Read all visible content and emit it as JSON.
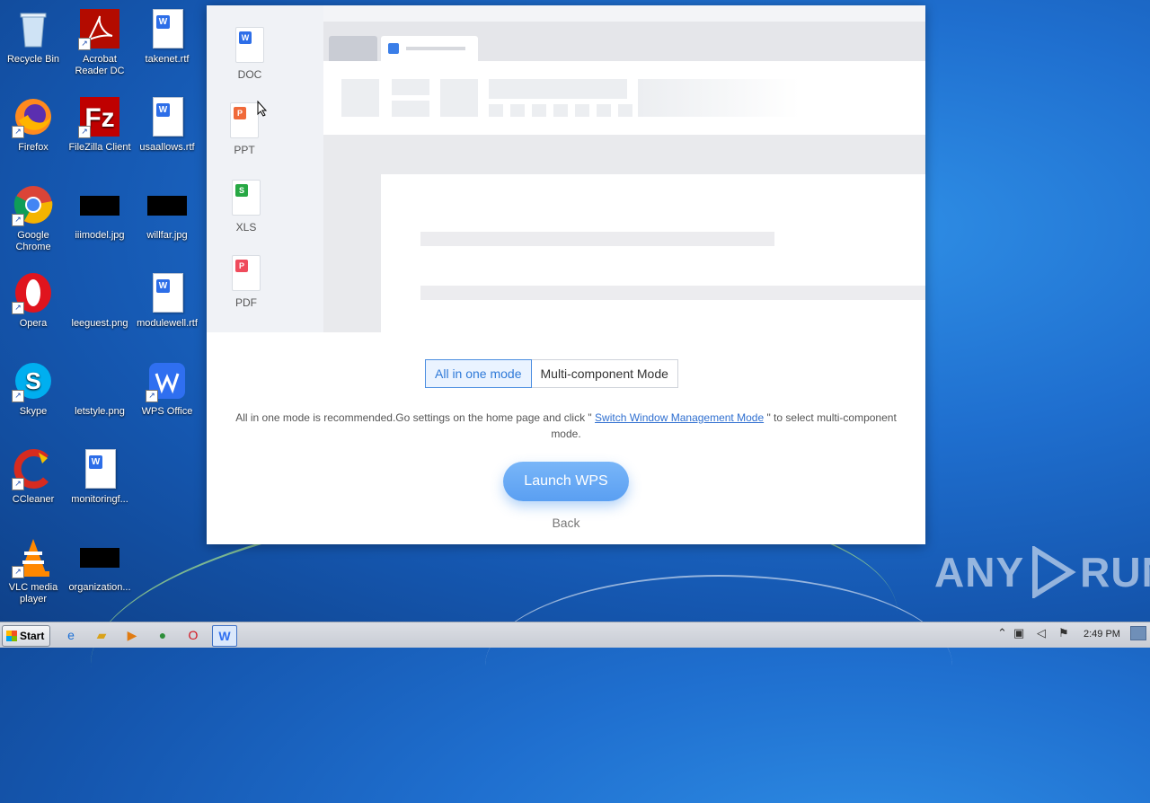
{
  "desktop": {
    "icons": [
      {
        "label": "Recycle Bin"
      },
      {
        "label": "Acrobat Reader DC"
      },
      {
        "label": "takenet.rtf"
      },
      {
        "label": "Firefox"
      },
      {
        "label": "FileZilla Client"
      },
      {
        "label": "usaallows.rtf"
      },
      {
        "label": "Google Chrome"
      },
      {
        "label": "iiimodel.jpg"
      },
      {
        "label": "willfar.jpg"
      },
      {
        "label": "Opera"
      },
      {
        "label": "leeguest.png"
      },
      {
        "label": "modulewell.rtf"
      },
      {
        "label": "Skype"
      },
      {
        "label": "letstyle.png"
      },
      {
        "label": "WPS Office"
      },
      {
        "label": "CCleaner"
      },
      {
        "label": "monitoringf..."
      },
      {
        "label": "VLC media player"
      },
      {
        "label": "organization..."
      }
    ]
  },
  "dialog": {
    "file_types": [
      {
        "label": "DOC",
        "badge": "W",
        "color": "#2d6ee8"
      },
      {
        "label": "PPT",
        "badge": "P",
        "color": "#f06a3a"
      },
      {
        "label": "XLS",
        "badge": "S",
        "color": "#27a844"
      },
      {
        "label": "PDF",
        "badge": "P",
        "color": "#ef4b5c"
      }
    ],
    "modes": {
      "all_in_one": "All in one mode",
      "multi_component": "Multi-component Mode",
      "selected": "all_in_one"
    },
    "hint": {
      "before": "All in one mode is recommended.Go settings on the home page and click \" ",
      "link": "Switch Window Management Mode",
      "after": " \" to select multi-component mode."
    },
    "launch_label": "Launch WPS",
    "back_label": "Back"
  },
  "watermark": {
    "left": "ANY",
    "right": "RUN"
  },
  "taskbar": {
    "start_label": "Start",
    "clock": "2:49 PM",
    "pinned": [
      "internet-explorer-icon",
      "explorer-folder-icon",
      "media-player-icon",
      "chrome-icon",
      "opera-icon",
      "wps-icon"
    ]
  },
  "colors": {
    "accent": "#2f7ad8",
    "launch": "#5a9ff2"
  }
}
